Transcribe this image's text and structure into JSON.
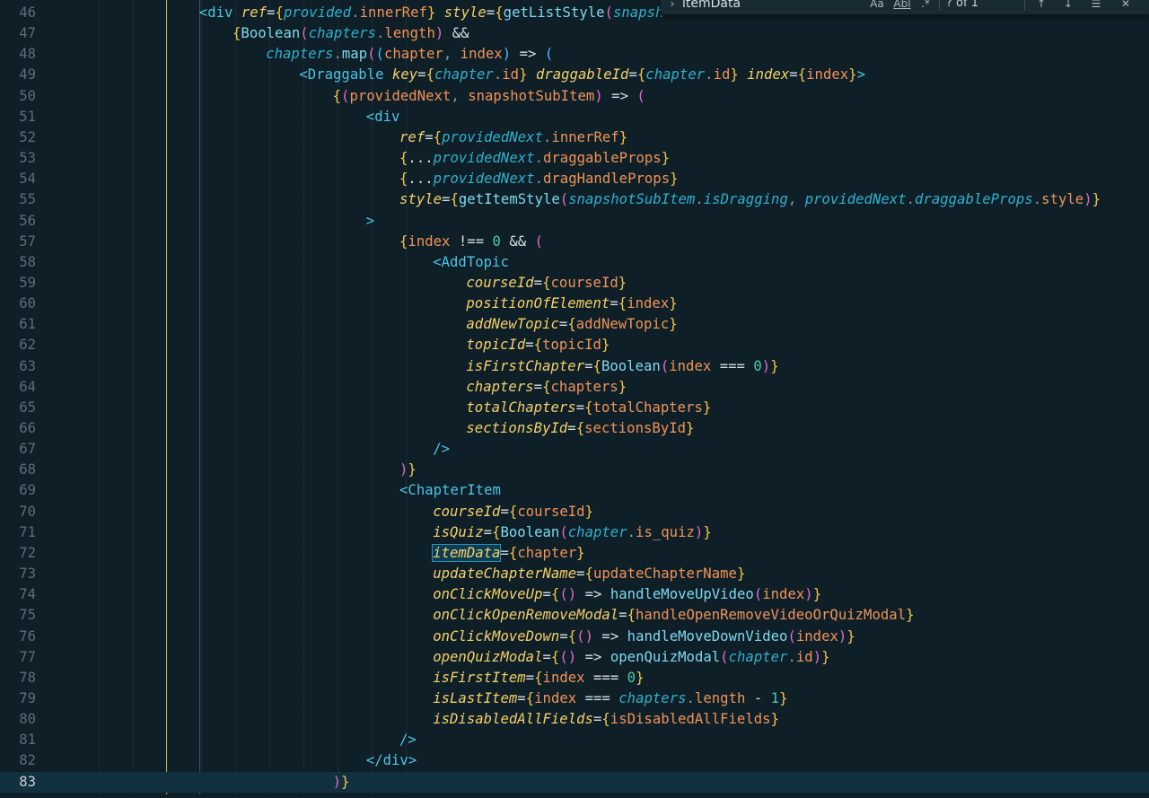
{
  "find": {
    "query": "itemData",
    "count_label": "? of 1",
    "case_label": "Aa",
    "word_label": "Abl",
    "regex_label": ".*"
  },
  "lines": [
    {
      "n": "46",
      "indent": 4,
      "tokens": [
        [
          "tag",
          "<div"
        ],
        [
          "sp",
          " "
        ],
        [
          "attr",
          "ref"
        ],
        [
          "op",
          "="
        ],
        [
          "brace",
          "{"
        ],
        [
          "prop",
          "provided"
        ],
        [
          "punc",
          "."
        ],
        [
          "var",
          "innerRef"
        ],
        [
          "brace",
          "}"
        ],
        [
          "sp",
          " "
        ],
        [
          "attr",
          "style"
        ],
        [
          "op",
          "="
        ],
        [
          "brace",
          "{"
        ],
        [
          "fn",
          "getListStyle"
        ],
        [
          "paren",
          "("
        ],
        [
          "prop",
          "snapsh"
        ]
      ]
    },
    {
      "n": "47",
      "indent": 5,
      "tokens": [
        [
          "brace",
          "{"
        ],
        [
          "fn",
          "Boolean"
        ],
        [
          "paren",
          "("
        ],
        [
          "prop",
          "chapters"
        ],
        [
          "punc",
          "."
        ],
        [
          "var",
          "length"
        ],
        [
          "paren",
          ")"
        ],
        [
          "sp",
          " "
        ],
        [
          "op",
          "&&"
        ]
      ]
    },
    {
      "n": "48",
      "indent": 6,
      "tokens": [
        [
          "prop",
          "chapters"
        ],
        [
          "punc",
          "."
        ],
        [
          "fn",
          "map"
        ],
        [
          "paren",
          "("
        ],
        [
          "sqr",
          "("
        ],
        [
          "var",
          "chapter"
        ],
        [
          "punc",
          ","
        ],
        [
          "sp",
          " "
        ],
        [
          "var",
          "index"
        ],
        [
          "sqr",
          ")"
        ],
        [
          "sp",
          " "
        ],
        [
          "op",
          "=>"
        ],
        [
          "sp",
          " "
        ],
        [
          "sqr",
          "("
        ]
      ]
    },
    {
      "n": "49",
      "indent": 7,
      "tokens": [
        [
          "tag",
          "<Draggable"
        ],
        [
          "sp",
          " "
        ],
        [
          "attr",
          "key"
        ],
        [
          "op",
          "="
        ],
        [
          "brace",
          "{"
        ],
        [
          "prop",
          "chapter"
        ],
        [
          "punc",
          "."
        ],
        [
          "var",
          "id"
        ],
        [
          "brace",
          "}"
        ],
        [
          "sp",
          " "
        ],
        [
          "attr",
          "draggableId"
        ],
        [
          "op",
          "="
        ],
        [
          "brace",
          "{"
        ],
        [
          "prop",
          "chapter"
        ],
        [
          "punc",
          "."
        ],
        [
          "var",
          "id"
        ],
        [
          "brace",
          "}"
        ],
        [
          "sp",
          " "
        ],
        [
          "attr",
          "index"
        ],
        [
          "op",
          "="
        ],
        [
          "brace",
          "{"
        ],
        [
          "var",
          "index"
        ],
        [
          "brace",
          "}"
        ],
        [
          "tag",
          ">"
        ]
      ]
    },
    {
      "n": "50",
      "indent": 8,
      "tokens": [
        [
          "brace",
          "{"
        ],
        [
          "paren",
          "("
        ],
        [
          "var",
          "providedNext"
        ],
        [
          "punc",
          ","
        ],
        [
          "sp",
          " "
        ],
        [
          "var",
          "snapshotSubItem"
        ],
        [
          "paren",
          ")"
        ],
        [
          "sp",
          " "
        ],
        [
          "op",
          "=>"
        ],
        [
          "sp",
          " "
        ],
        [
          "paren",
          "("
        ]
      ]
    },
    {
      "n": "51",
      "indent": 9,
      "tokens": [
        [
          "tag",
          "<div"
        ]
      ]
    },
    {
      "n": "52",
      "indent": 10,
      "tokens": [
        [
          "attr",
          "ref"
        ],
        [
          "op",
          "="
        ],
        [
          "brace",
          "{"
        ],
        [
          "prop",
          "providedNext"
        ],
        [
          "punc",
          "."
        ],
        [
          "var",
          "innerRef"
        ],
        [
          "brace",
          "}"
        ]
      ]
    },
    {
      "n": "53",
      "indent": 10,
      "tokens": [
        [
          "brace",
          "{"
        ],
        [
          "op",
          "..."
        ],
        [
          "prop",
          "providedNext"
        ],
        [
          "punc",
          "."
        ],
        [
          "var",
          "draggableProps"
        ],
        [
          "brace",
          "}"
        ]
      ]
    },
    {
      "n": "54",
      "indent": 10,
      "tokens": [
        [
          "brace",
          "{"
        ],
        [
          "op",
          "..."
        ],
        [
          "prop",
          "providedNext"
        ],
        [
          "punc",
          "."
        ],
        [
          "var",
          "dragHandleProps"
        ],
        [
          "brace",
          "}"
        ]
      ]
    },
    {
      "n": "55",
      "indent": 10,
      "tokens": [
        [
          "attr",
          "style"
        ],
        [
          "op",
          "="
        ],
        [
          "brace",
          "{"
        ],
        [
          "fn",
          "getItemStyle"
        ],
        [
          "paren",
          "("
        ],
        [
          "prop",
          "snapshotSubItem"
        ],
        [
          "punc",
          "."
        ],
        [
          "prop",
          "isDragging"
        ],
        [
          "punc",
          ","
        ],
        [
          "sp",
          " "
        ],
        [
          "prop",
          "providedNext"
        ],
        [
          "punc",
          "."
        ],
        [
          "prop",
          "draggableProps"
        ],
        [
          "punc",
          "."
        ],
        [
          "var",
          "style"
        ],
        [
          "paren",
          ")"
        ],
        [
          "brace",
          "}"
        ]
      ]
    },
    {
      "n": "56",
      "indent": 9,
      "tokens": [
        [
          "tag",
          ">"
        ]
      ]
    },
    {
      "n": "57",
      "indent": 10,
      "tokens": [
        [
          "brace",
          "{"
        ],
        [
          "var",
          "index"
        ],
        [
          "sp",
          " "
        ],
        [
          "op",
          "!=="
        ],
        [
          "sp",
          " "
        ],
        [
          "num",
          "0"
        ],
        [
          "sp",
          " "
        ],
        [
          "op",
          "&&"
        ],
        [
          "sp",
          " "
        ],
        [
          "paren",
          "("
        ]
      ]
    },
    {
      "n": "58",
      "indent": 11,
      "tokens": [
        [
          "tag",
          "<AddTopic"
        ]
      ]
    },
    {
      "n": "59",
      "indent": 12,
      "tokens": [
        [
          "attr",
          "courseId"
        ],
        [
          "op",
          "="
        ],
        [
          "brace",
          "{"
        ],
        [
          "var",
          "courseId"
        ],
        [
          "brace",
          "}"
        ]
      ]
    },
    {
      "n": "60",
      "indent": 12,
      "tokens": [
        [
          "attr",
          "positionOfElement"
        ],
        [
          "op",
          "="
        ],
        [
          "brace",
          "{"
        ],
        [
          "var",
          "index"
        ],
        [
          "brace",
          "}"
        ]
      ]
    },
    {
      "n": "61",
      "indent": 12,
      "tokens": [
        [
          "attr",
          "addNewTopic"
        ],
        [
          "op",
          "="
        ],
        [
          "brace",
          "{"
        ],
        [
          "var",
          "addNewTopic"
        ],
        [
          "brace",
          "}"
        ]
      ]
    },
    {
      "n": "62",
      "indent": 12,
      "tokens": [
        [
          "attr",
          "topicId"
        ],
        [
          "op",
          "="
        ],
        [
          "brace",
          "{"
        ],
        [
          "var",
          "topicId"
        ],
        [
          "brace",
          "}"
        ]
      ]
    },
    {
      "n": "63",
      "indent": 12,
      "tokens": [
        [
          "attr",
          "isFirstChapter"
        ],
        [
          "op",
          "="
        ],
        [
          "brace",
          "{"
        ],
        [
          "fn",
          "Boolean"
        ],
        [
          "paren",
          "("
        ],
        [
          "var",
          "index"
        ],
        [
          "sp",
          " "
        ],
        [
          "op",
          "==="
        ],
        [
          "sp",
          " "
        ],
        [
          "num",
          "0"
        ],
        [
          "paren",
          ")"
        ],
        [
          "brace",
          "}"
        ]
      ]
    },
    {
      "n": "64",
      "indent": 12,
      "tokens": [
        [
          "attr",
          "chapters"
        ],
        [
          "op",
          "="
        ],
        [
          "brace",
          "{"
        ],
        [
          "var",
          "chapters"
        ],
        [
          "brace",
          "}"
        ]
      ]
    },
    {
      "n": "65",
      "indent": 12,
      "tokens": [
        [
          "attr",
          "totalChapters"
        ],
        [
          "op",
          "="
        ],
        [
          "brace",
          "{"
        ],
        [
          "var",
          "totalChapters"
        ],
        [
          "brace",
          "}"
        ]
      ]
    },
    {
      "n": "66",
      "indent": 12,
      "tokens": [
        [
          "attr",
          "sectionsById"
        ],
        [
          "op",
          "="
        ],
        [
          "brace",
          "{"
        ],
        [
          "var",
          "sectionsById"
        ],
        [
          "brace",
          "}"
        ]
      ]
    },
    {
      "n": "67",
      "indent": 11,
      "tokens": [
        [
          "tag",
          "/>"
        ]
      ]
    },
    {
      "n": "68",
      "indent": 10,
      "tokens": [
        [
          "paren",
          ")"
        ],
        [
          "brace",
          "}"
        ]
      ]
    },
    {
      "n": "69",
      "indent": 10,
      "tokens": [
        [
          "tag",
          "<ChapterItem"
        ]
      ]
    },
    {
      "n": "70",
      "indent": 11,
      "tokens": [
        [
          "attr",
          "courseId"
        ],
        [
          "op",
          "="
        ],
        [
          "brace",
          "{"
        ],
        [
          "var",
          "courseId"
        ],
        [
          "brace",
          "}"
        ]
      ]
    },
    {
      "n": "71",
      "indent": 11,
      "tokens": [
        [
          "attr",
          "isQuiz"
        ],
        [
          "op",
          "="
        ],
        [
          "brace",
          "{"
        ],
        [
          "fn",
          "Boolean"
        ],
        [
          "paren",
          "("
        ],
        [
          "prop",
          "chapter"
        ],
        [
          "punc",
          "."
        ],
        [
          "var",
          "is_quiz"
        ],
        [
          "paren",
          ")"
        ],
        [
          "brace",
          "}"
        ]
      ]
    },
    {
      "n": "72",
      "indent": 11,
      "tokens": [
        [
          "match",
          "itemData"
        ],
        [
          "op",
          "="
        ],
        [
          "brace",
          "{"
        ],
        [
          "var",
          "chapter"
        ],
        [
          "brace",
          "}"
        ]
      ]
    },
    {
      "n": "73",
      "indent": 11,
      "tokens": [
        [
          "attr",
          "updateChapterName"
        ],
        [
          "op",
          "="
        ],
        [
          "brace",
          "{"
        ],
        [
          "var",
          "updateChapterName"
        ],
        [
          "brace",
          "}"
        ]
      ]
    },
    {
      "n": "74",
      "indent": 11,
      "tokens": [
        [
          "attr",
          "onClickMoveUp"
        ],
        [
          "op",
          "="
        ],
        [
          "brace",
          "{"
        ],
        [
          "paren",
          "("
        ],
        [
          "paren",
          ")"
        ],
        [
          "sp",
          " "
        ],
        [
          "op",
          "=>"
        ],
        [
          "sp",
          " "
        ],
        [
          "fn",
          "handleMoveUpVideo"
        ],
        [
          "paren",
          "("
        ],
        [
          "var",
          "index"
        ],
        [
          "paren",
          ")"
        ],
        [
          "brace",
          "}"
        ]
      ]
    },
    {
      "n": "75",
      "indent": 11,
      "tokens": [
        [
          "attr",
          "onClickOpenRemoveModal"
        ],
        [
          "op",
          "="
        ],
        [
          "brace",
          "{"
        ],
        [
          "var",
          "handleOpenRemoveVideoOrQuizModal"
        ],
        [
          "brace",
          "}"
        ]
      ]
    },
    {
      "n": "76",
      "indent": 11,
      "tokens": [
        [
          "attr",
          "onClickMoveDown"
        ],
        [
          "op",
          "="
        ],
        [
          "brace",
          "{"
        ],
        [
          "paren",
          "("
        ],
        [
          "paren",
          ")"
        ],
        [
          "sp",
          " "
        ],
        [
          "op",
          "=>"
        ],
        [
          "sp",
          " "
        ],
        [
          "fn",
          "handleMoveDownVideo"
        ],
        [
          "paren",
          "("
        ],
        [
          "var",
          "index"
        ],
        [
          "paren",
          ")"
        ],
        [
          "brace",
          "}"
        ]
      ]
    },
    {
      "n": "77",
      "indent": 11,
      "tokens": [
        [
          "attr",
          "openQuizModal"
        ],
        [
          "op",
          "="
        ],
        [
          "brace",
          "{"
        ],
        [
          "paren",
          "("
        ],
        [
          "paren",
          ")"
        ],
        [
          "sp",
          " "
        ],
        [
          "op",
          "=>"
        ],
        [
          "sp",
          " "
        ],
        [
          "fn",
          "openQuizModal"
        ],
        [
          "paren",
          "("
        ],
        [
          "prop",
          "chapter"
        ],
        [
          "punc",
          "."
        ],
        [
          "var",
          "id"
        ],
        [
          "paren",
          ")"
        ],
        [
          "brace",
          "}"
        ]
      ]
    },
    {
      "n": "78",
      "indent": 11,
      "tokens": [
        [
          "attr",
          "isFirstItem"
        ],
        [
          "op",
          "="
        ],
        [
          "brace",
          "{"
        ],
        [
          "var",
          "index"
        ],
        [
          "sp",
          " "
        ],
        [
          "op",
          "==="
        ],
        [
          "sp",
          " "
        ],
        [
          "num",
          "0"
        ],
        [
          "brace",
          "}"
        ]
      ]
    },
    {
      "n": "79",
      "indent": 11,
      "tokens": [
        [
          "attr",
          "isLastItem"
        ],
        [
          "op",
          "="
        ],
        [
          "brace",
          "{"
        ],
        [
          "var",
          "index"
        ],
        [
          "sp",
          " "
        ],
        [
          "op",
          "==="
        ],
        [
          "sp",
          " "
        ],
        [
          "prop",
          "chapters"
        ],
        [
          "punc",
          "."
        ],
        [
          "var",
          "length"
        ],
        [
          "sp",
          " "
        ],
        [
          "op",
          "-"
        ],
        [
          "sp",
          " "
        ],
        [
          "num",
          "1"
        ],
        [
          "brace",
          "}"
        ]
      ]
    },
    {
      "n": "80",
      "indent": 11,
      "tokens": [
        [
          "attr",
          "isDisabledAllFields"
        ],
        [
          "op",
          "="
        ],
        [
          "brace",
          "{"
        ],
        [
          "var",
          "isDisabledAllFields"
        ],
        [
          "brace",
          "}"
        ]
      ]
    },
    {
      "n": "81",
      "indent": 10,
      "tokens": [
        [
          "tag",
          "/>"
        ]
      ]
    },
    {
      "n": "82",
      "indent": 9,
      "tokens": [
        [
          "tag",
          "</div>"
        ]
      ]
    },
    {
      "n": "83",
      "indent": 8,
      "current": true,
      "tokens": [
        [
          "paren",
          ")"
        ],
        [
          "brace",
          "}"
        ]
      ]
    }
  ]
}
